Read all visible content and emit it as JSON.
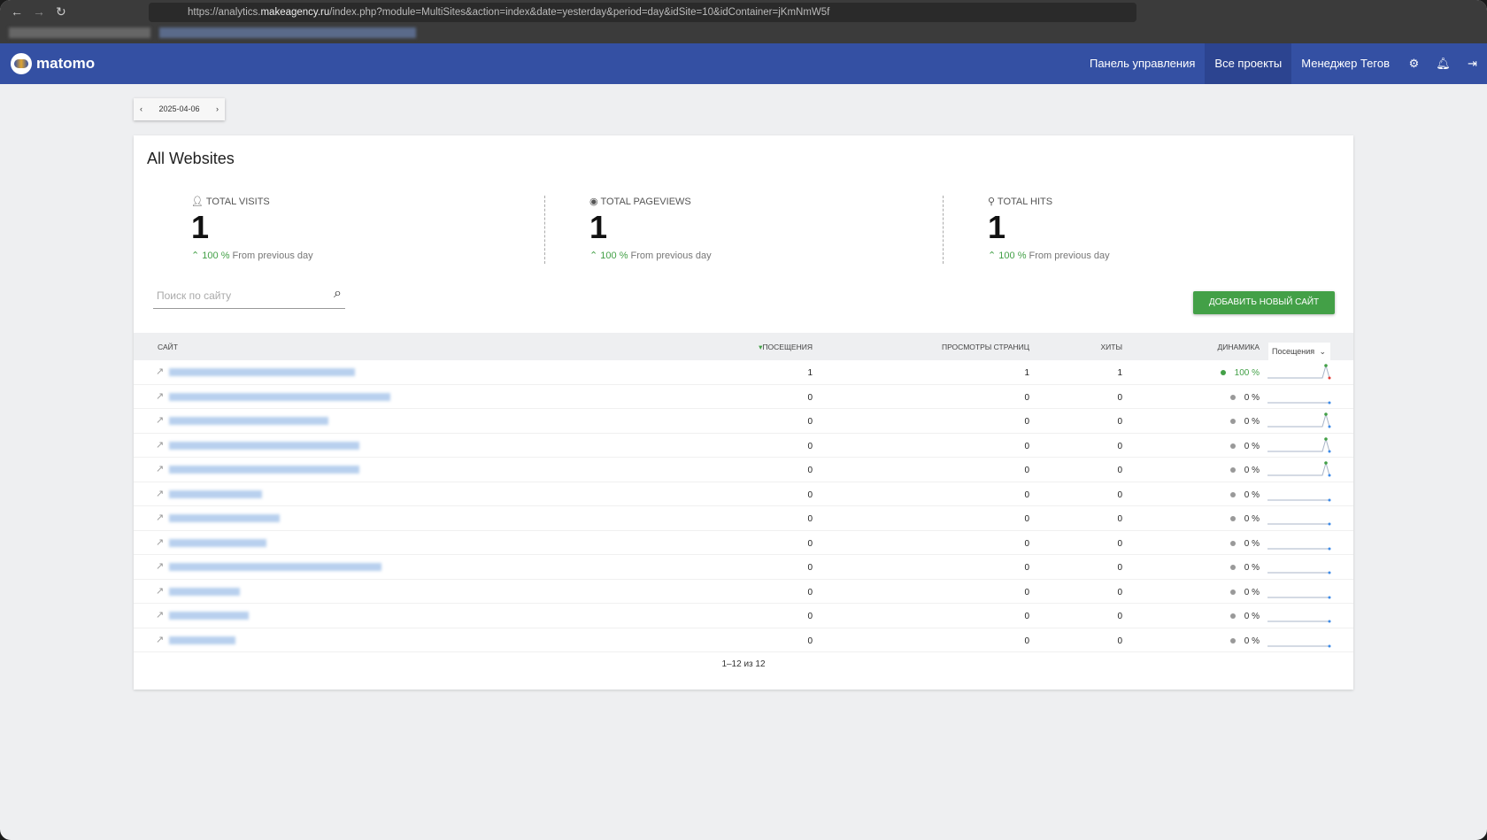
{
  "browser": {
    "url_prefix": "https://analytics.",
    "url_domain": "makeagency.ru",
    "url_rest": "/index.php?module=MultiSites&action=index&date=yesterday&period=day&idSite=10&idContainer=jKmNmW5f"
  },
  "nav": {
    "logo": "matomo",
    "items": [
      "Панель управления",
      "Все проекты",
      "Менеджер Тегов"
    ],
    "active": 1
  },
  "date": {
    "value": "2025-04-06"
  },
  "card": {
    "title": "All Websites"
  },
  "kpis": [
    {
      "label": "Total visits",
      "value": "1",
      "change": "100 %",
      "suffix": "From previous day",
      "icon": "user-icon"
    },
    {
      "label": "Total pageviews",
      "value": "1",
      "change": "100 %",
      "suffix": "From previous day",
      "icon": "eye-icon"
    },
    {
      "label": "Total hits",
      "value": "1",
      "change": "100 %",
      "suffix": "From previous day",
      "icon": "hits-icon"
    }
  ],
  "search": {
    "placeholder": "Поиск по сайту"
  },
  "add_button": "ДОБАВИТЬ НОВЫЙ САЙТ",
  "table": {
    "headers": {
      "site": "Сайт",
      "visits": "Посещения",
      "pageviews": "Просмотры страниц",
      "hits": "Хиты",
      "dynamics": "Динамика"
    },
    "metric_select": "Посещения",
    "rows": [
      {
        "visits": "1",
        "pageviews": "1",
        "hits": "1",
        "change": "100 %",
        "trend": "up",
        "spike": true,
        "end_red": true
      },
      {
        "visits": "0",
        "pageviews": "0",
        "hits": "0",
        "change": "0 %",
        "trend": "flat",
        "spike": false
      },
      {
        "visits": "0",
        "pageviews": "0",
        "hits": "0",
        "change": "0 %",
        "trend": "flat",
        "spike": true
      },
      {
        "visits": "0",
        "pageviews": "0",
        "hits": "0",
        "change": "0 %",
        "trend": "flat",
        "spike": true
      },
      {
        "visits": "0",
        "pageviews": "0",
        "hits": "0",
        "change": "0 %",
        "trend": "flat",
        "spike": true
      },
      {
        "visits": "0",
        "pageviews": "0",
        "hits": "0",
        "change": "0 %",
        "trend": "flat",
        "spike": false
      },
      {
        "visits": "0",
        "pageviews": "0",
        "hits": "0",
        "change": "0 %",
        "trend": "flat",
        "spike": false
      },
      {
        "visits": "0",
        "pageviews": "0",
        "hits": "0",
        "change": "0 %",
        "trend": "flat",
        "spike": false
      },
      {
        "visits": "0",
        "pageviews": "0",
        "hits": "0",
        "change": "0 %",
        "trend": "flat",
        "spike": false
      },
      {
        "visits": "0",
        "pageviews": "0",
        "hits": "0",
        "change": "0 %",
        "trend": "flat",
        "spike": false
      },
      {
        "visits": "0",
        "pageviews": "0",
        "hits": "0",
        "change": "0 %",
        "trend": "flat",
        "spike": false
      },
      {
        "visits": "0",
        "pageviews": "0",
        "hits": "0",
        "change": "0 %",
        "trend": "flat",
        "spike": false
      }
    ]
  },
  "pagination": "1–12 из 12",
  "colors": {
    "brand": "#3450a3",
    "green": "#43a047"
  }
}
